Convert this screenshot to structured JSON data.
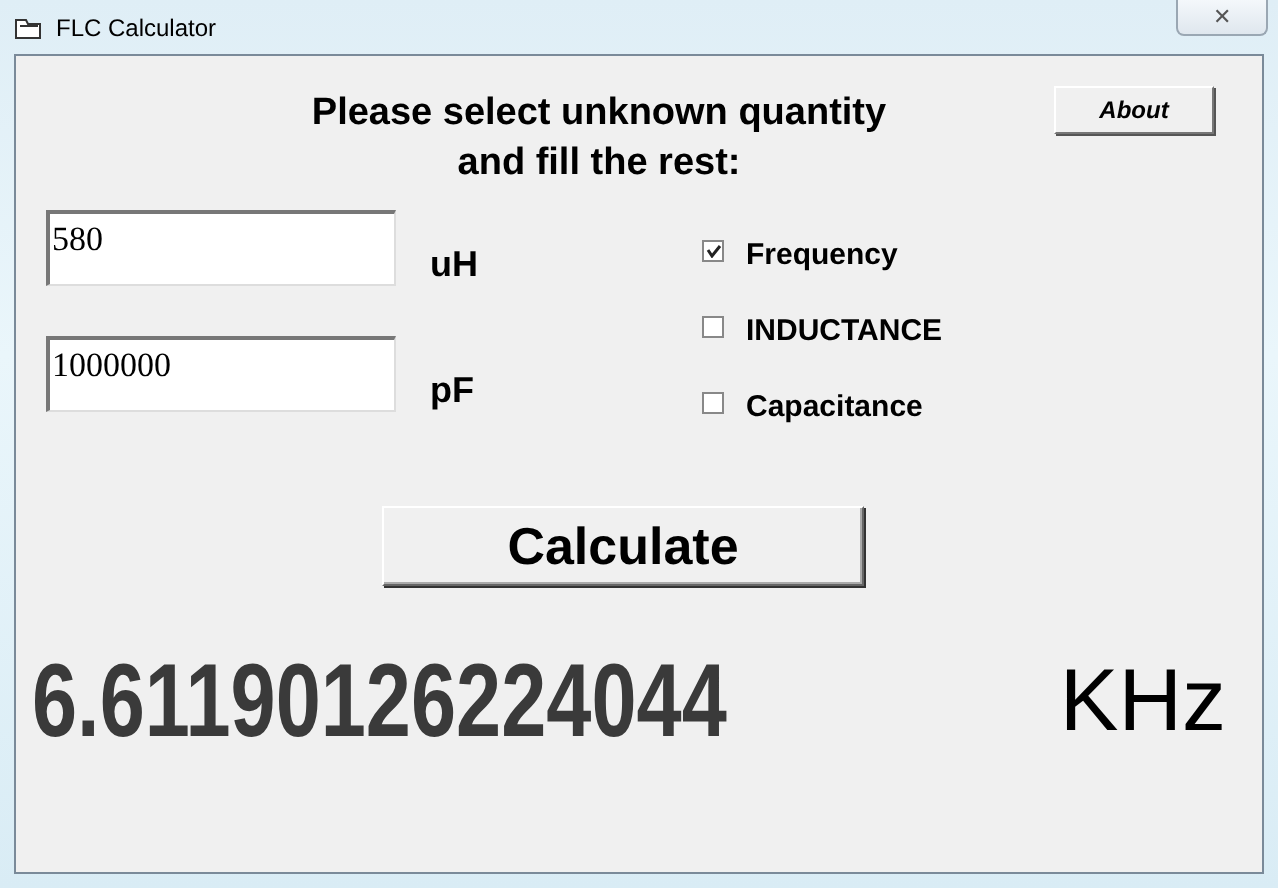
{
  "window": {
    "title": "FLC Calculator",
    "close": "✕"
  },
  "heading": {
    "line1": "Please select unknown quantity",
    "line2": "and fill the rest:"
  },
  "about_button": "About",
  "inputs": [
    {
      "value": "580",
      "unit": "uH"
    },
    {
      "value": "1000000",
      "unit": "pF"
    }
  ],
  "options": [
    {
      "label": "Frequency",
      "checked": true
    },
    {
      "label": "INDUCTANCE",
      "checked": false
    },
    {
      "label": "Capacitance",
      "checked": false
    }
  ],
  "calculate_button": "Calculate",
  "result": {
    "value": "6.61190126224044",
    "unit": "KHz"
  }
}
